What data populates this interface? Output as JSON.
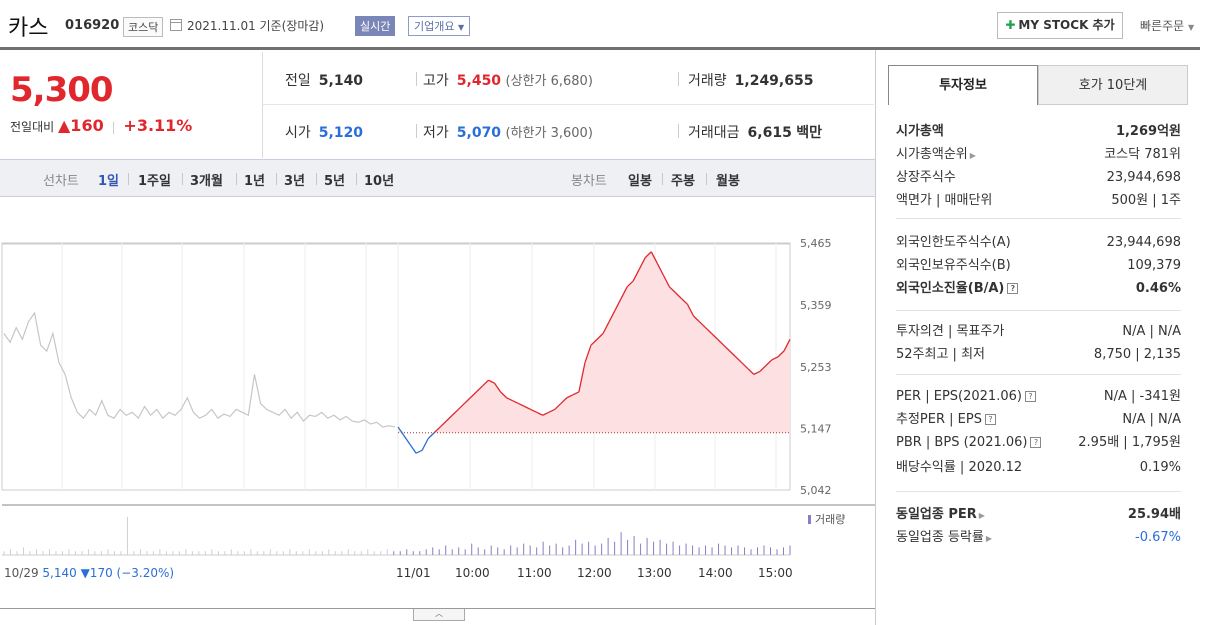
{
  "header": {
    "name": "카스",
    "code": "016920",
    "market": "코스닥",
    "date": "2021.11.01 기준(장마감)",
    "realtime": "실시간",
    "overview": "기업개요",
    "mystock": "MY STOCK 추가",
    "quick_order": "빠른주문"
  },
  "quote": {
    "price": "5,300",
    "change_label": "전일대비",
    "change": "▲160",
    "change_pct": "+3.11%",
    "prev_label": "전일",
    "prev": "5,140",
    "high_label": "고가",
    "high": "5,450",
    "upper_limit": "(상한가 6,680)",
    "volume_label": "거래량",
    "volume": "1,249,655",
    "open_label": "시가",
    "open": "5,120",
    "low_label": "저가",
    "low": "5,070",
    "lower_limit": "(하한가 3,600)",
    "amount_label": "거래대금",
    "amount": "6,615",
    "amount_unit": "백만"
  },
  "tabs": {
    "line_label": "선차트",
    "line_items": [
      "1일",
      "1주일",
      "3개월",
      "1년",
      "3년",
      "5년",
      "10년"
    ],
    "candle_label": "봉차트",
    "candle_items": [
      "일봉",
      "주봉",
      "월봉"
    ]
  },
  "chart_data": {
    "type": "line",
    "ylabels": [
      "5,465",
      "5,359",
      "5,253",
      "5,147",
      "5,042"
    ],
    "ylim": [
      5042,
      5465
    ],
    "prev_close": 5140,
    "xlabels": [
      "10/29",
      "11/01",
      "10:00",
      "11:00",
      "12:00",
      "13:00",
      "14:00",
      "15:00"
    ],
    "prev_day_info": "5,140",
    "prev_day_change": "▼170",
    "prev_day_pct": "(−3.20%)",
    "volume_label": "거래량",
    "series_prev_day": [
      5310,
      5295,
      5320,
      5300,
      5330,
      5345,
      5290,
      5280,
      5310,
      5260,
      5240,
      5200,
      5175,
      5165,
      5180,
      5170,
      5195,
      5170,
      5165,
      5180,
      5170,
      5175,
      5165,
      5185,
      5170,
      5180,
      5165,
      5175,
      5170,
      5180,
      5200,
      5175,
      5165,
      5170,
      5180,
      5165,
      5172,
      5168,
      5180,
      5175,
      5170,
      5240,
      5190,
      5180,
      5175,
      5170,
      5180,
      5165,
      5175,
      5160,
      5170,
      5168,
      5175,
      5165,
      5170,
      5162,
      5168,
      5160,
      5158,
      5162,
      5155,
      5158,
      5150,
      5152,
      5150
    ],
    "series_today": [
      5150,
      5135,
      5120,
      5105,
      5110,
      5130,
      5140,
      5150,
      5160,
      5170,
      5180,
      5190,
      5200,
      5210,
      5220,
      5230,
      5225,
      5210,
      5200,
      5195,
      5190,
      5185,
      5180,
      5175,
      5170,
      5175,
      5180,
      5190,
      5200,
      5205,
      5210,
      5260,
      5290,
      5300,
      5310,
      5330,
      5350,
      5370,
      5390,
      5400,
      5420,
      5440,
      5450,
      5430,
      5410,
      5390,
      5380,
      5370,
      5360,
      5340,
      5330,
      5320,
      5310,
      5300,
      5290,
      5280,
      5270,
      5260,
      5250,
      5240,
      5245,
      5255,
      5265,
      5270,
      5280,
      5300
    ],
    "volume": [
      2,
      3,
      2,
      4,
      2,
      3,
      2,
      3,
      2,
      2,
      3,
      2,
      2,
      3,
      2,
      2,
      3,
      2,
      2,
      20,
      2,
      3,
      2,
      2,
      3,
      2,
      2,
      2,
      3,
      2,
      2,
      2,
      3,
      2,
      2,
      3,
      2,
      2,
      3,
      2,
      2,
      3,
      2,
      2,
      3,
      2,
      2,
      3,
      2,
      2,
      3,
      2,
      2,
      3,
      2,
      2,
      3,
      2,
      2,
      3,
      2,
      2,
      3,
      2,
      2,
      3,
      4,
      3,
      5,
      3,
      4,
      3,
      6,
      4,
      3,
      5,
      4,
      3,
      5,
      4,
      6,
      5,
      4,
      7,
      5,
      6,
      4,
      5,
      8,
      6,
      7,
      5,
      6,
      9,
      7,
      12,
      8,
      10,
      6,
      9,
      7,
      8,
      6,
      7,
      5,
      6,
      5,
      4,
      5,
      4,
      6,
      5,
      4,
      5,
      4,
      3,
      4,
      5,
      4,
      3,
      4,
      5
    ]
  },
  "right_panel": {
    "tab_on": "투자정보",
    "tab_off": "호가 10단계",
    "rows": [
      {
        "l": "시가총액",
        "r": "1,269억원"
      },
      {
        "l": "시가총액순위",
        "r": "코스닥 781위"
      },
      {
        "l": "상장주식수",
        "r": "23,944,698"
      },
      {
        "l": "액면가 | 매매단위",
        "r": "500원 | 1주"
      },
      {
        "l": "외국인한도주식수(A)",
        "r": "23,944,698"
      },
      {
        "l": "외국인보유주식수(B)",
        "r": "109,379"
      },
      {
        "l": "외국인소진율(B/A)",
        "r": "0.46%"
      },
      {
        "l": "투자의견 | 목표주가",
        "r": "N/A | N/A"
      },
      {
        "l": "52주최고 | 최저",
        "r": "8,750 | 2,135"
      },
      {
        "l": "PER | EPS(2021.06)",
        "r": "N/A | -341원"
      },
      {
        "l": "추정PER | EPS",
        "r": "N/A | N/A"
      },
      {
        "l": "PBR | BPS (2021.06)",
        "r": "2.95배 | 1,795원"
      },
      {
        "l": "배당수익률 | 2020.12",
        "r": "0.19%"
      },
      {
        "l": "동일업종 PER",
        "r": "25.94배"
      },
      {
        "l": "동일업종 등락률",
        "r": "-0.67%"
      }
    ]
  },
  "colors": {
    "up": "#e0272e",
    "down": "#2a6fd8",
    "accent": "#3456b5"
  }
}
